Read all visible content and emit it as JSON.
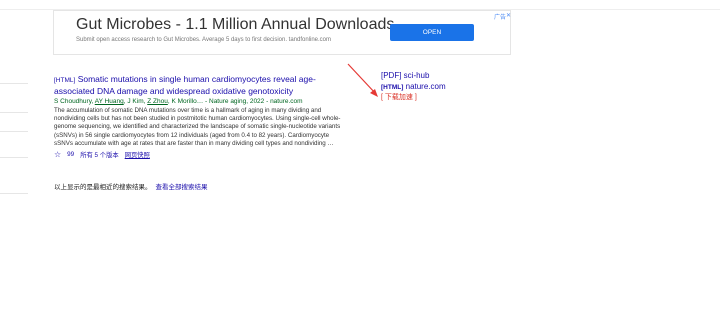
{
  "ad": {
    "title": "Gut Microbes - 1.1 Million Annual Downloads",
    "subtitle": "Submit open access research to Gut Microbes. Average 5 days to first decision. tandfonline.com",
    "button": "OPEN",
    "choice": "广告",
    "close": "✕"
  },
  "result": {
    "tag": "[HTML]",
    "title": "Somatic mutations in single human cardiomyocytes reveal age-associated DNA damage and widespread oxidative genotoxicity",
    "authors": {
      "a1": "S Choudhury, ",
      "a2": "AY Huang",
      "a3": ", J Kim, ",
      "a4": "Z Zhou",
      "a5": ", K Morillo… - Nature aging, 2022 - nature.com"
    },
    "snippet": "The accumulation of somatic DNA mutations over time is a hallmark of aging in many dividing and nondividing cells but has not been studied in postmitotic human cardiomyocytes. Using single-cell whole-genome sequencing, we identified and characterized the landscape of somatic single-nucleotide variants (sSNVs) in 56 single cardiomyocytes from 12 individuals (aged from 0.4 to 82 years). Cardiomyocyte sSNVs accumulate with age at rates that are faster than in many dividing cell types and nondividing …",
    "star": "☆",
    "quote": "99",
    "versions": "所有 5 个版本",
    "snapshot": "网页快照"
  },
  "footer": {
    "note": "以上显示的是最相近的搜索结果。",
    "more": "查看全部搜索结果"
  },
  "side": {
    "pdf": "[PDF] sci-hub",
    "html_tag": "[HTML]",
    "html_site": " nature.com",
    "download": "[ 下载加速 ]"
  }
}
